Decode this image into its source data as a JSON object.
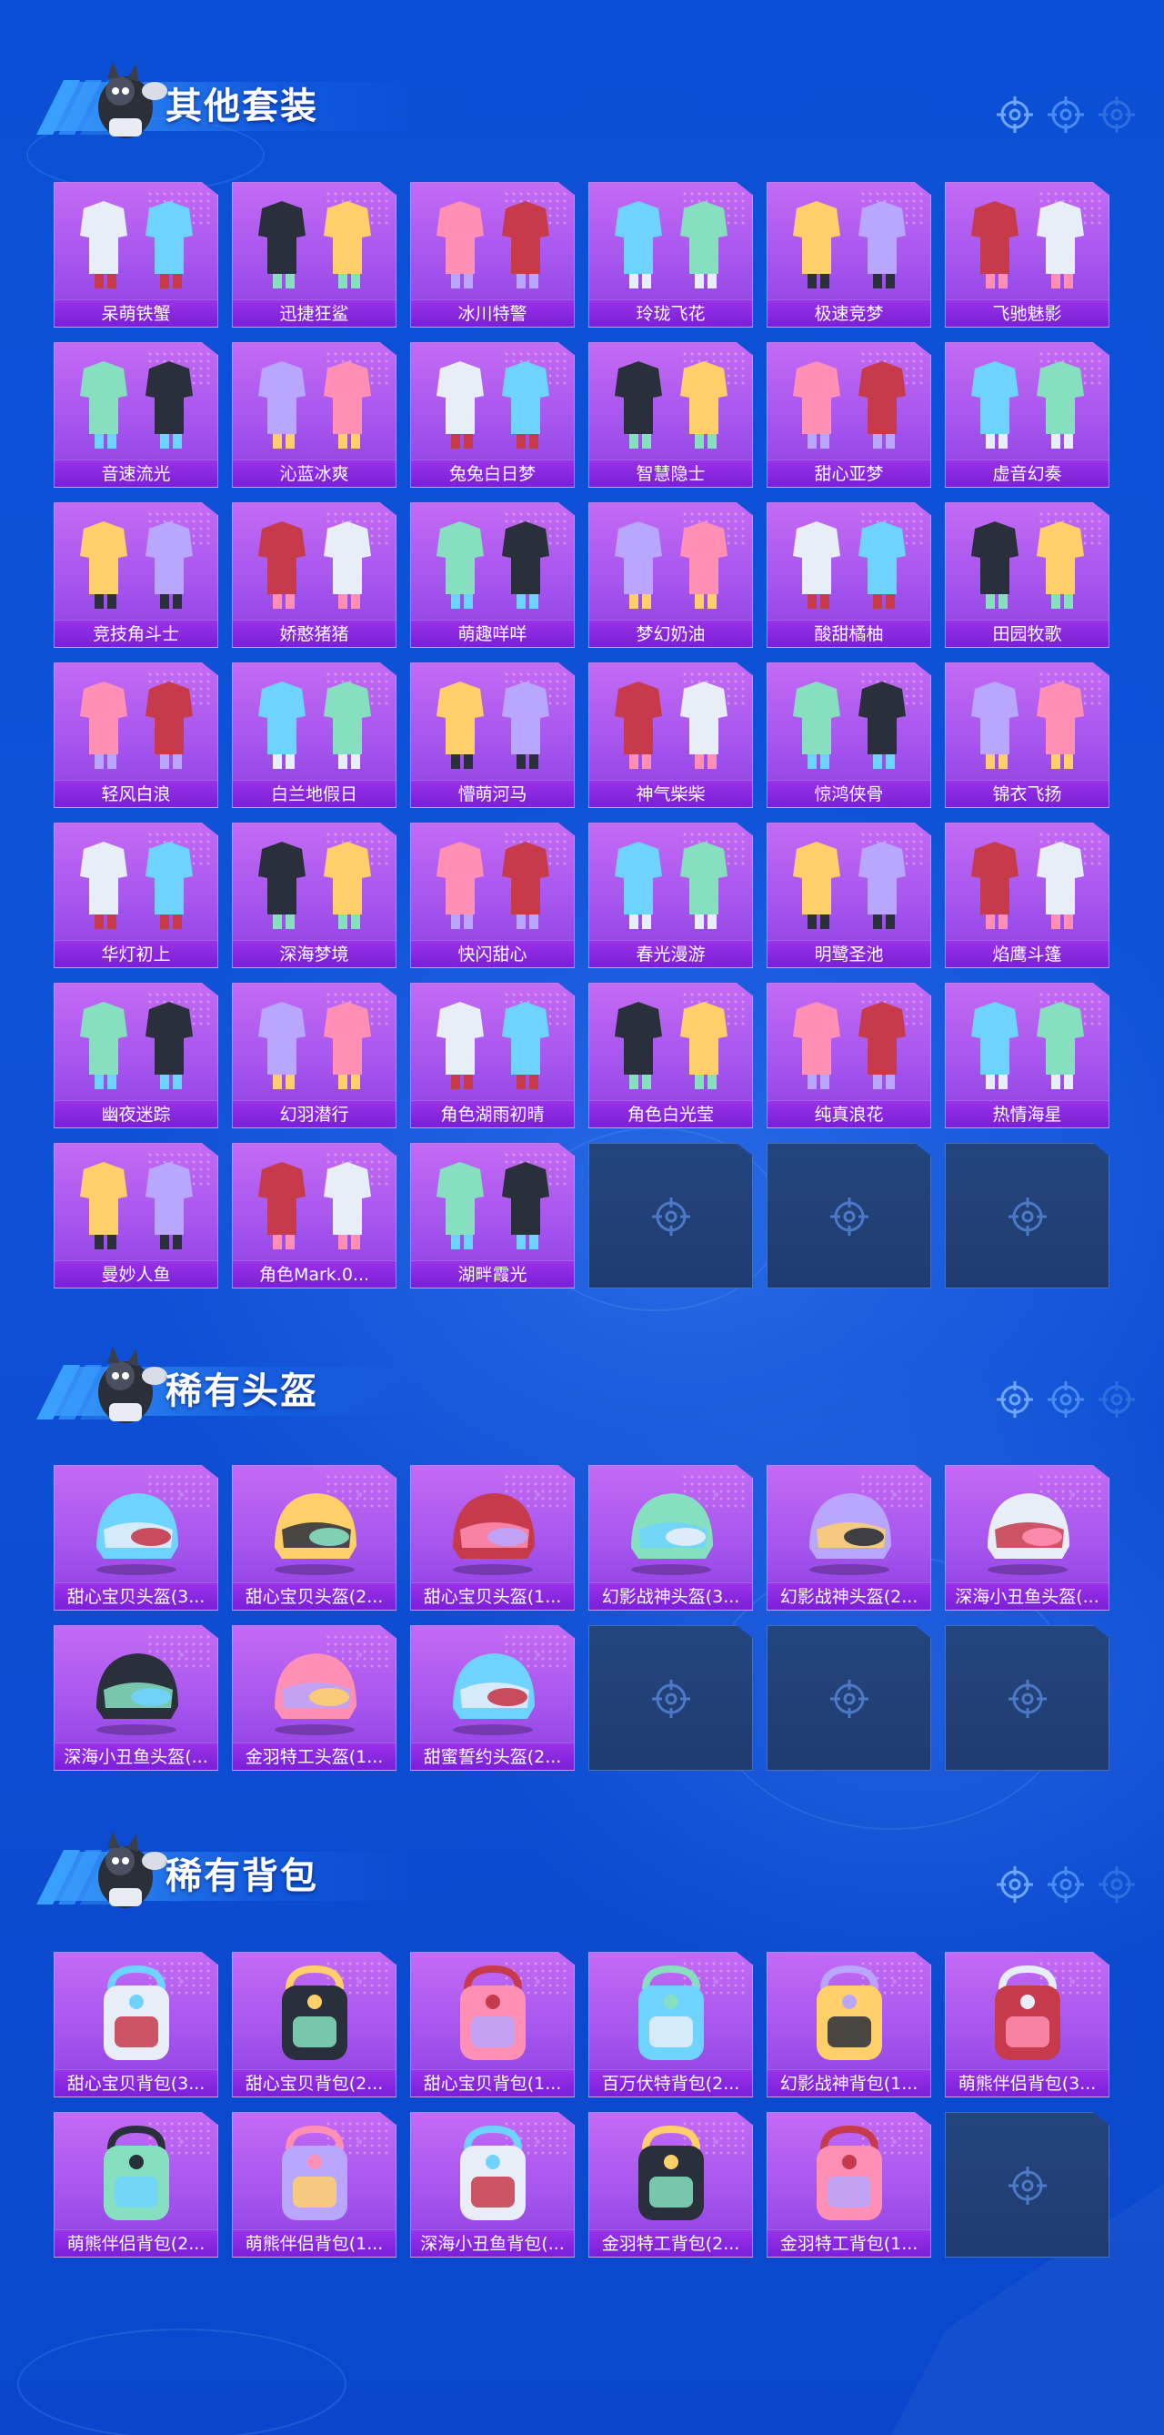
{
  "sections": {
    "suits": {
      "title": "其他套装",
      "items": [
        "呆萌铁蟹",
        "迅捷狂鲨",
        "冰川特警",
        "玲珑飞花",
        "极速竞梦",
        "飞驰魅影",
        "音速流光",
        "沁蓝冰爽",
        "兔兔白日梦",
        "智慧隐士",
        "甜心亚梦",
        "虚音幻奏",
        "竞技角斗士",
        "娇憨猪猪",
        "萌趣咩咩",
        "梦幻奶油",
        "酸甜橘柚",
        "田园牧歌",
        "轻风白浪",
        "白兰地假日",
        "懵萌河马",
        "神气柴柴",
        "惊鸿侠骨",
        "锦衣飞扬",
        "华灯初上",
        "深海梦境",
        "快闪甜心",
        "春光漫游",
        "明鹭圣池",
        "焰鹰斗篷",
        "幽夜迷踪",
        "幻羽潜行",
        "角色湖雨初晴",
        "角色白光莹",
        "纯真浪花",
        "热情海星",
        "曼妙人鱼",
        "角色Mark.0...",
        "湖畔霞光"
      ],
      "empty_slots": 3
    },
    "helmets": {
      "title": "稀有头盔",
      "items": [
        "甜心宝贝头盔(3...",
        "甜心宝贝头盔(2...",
        "甜心宝贝头盔(1...",
        "幻影战神头盔(3...",
        "幻影战神头盔(2...",
        "深海小丑鱼头盔(...",
        "深海小丑鱼头盔(...",
        "金羽特工头盔(1...",
        "甜蜜誓约头盔(2..."
      ],
      "empty_slots": 3
    },
    "backpacks": {
      "title": "稀有背包",
      "items": [
        "甜心宝贝背包(3...",
        "甜心宝贝背包(2...",
        "甜心宝贝背包(1...",
        "百万伏特背包(2...",
        "幻影战神背包(1...",
        "萌熊伴侣背包(3...",
        "萌熊伴侣背包(2...",
        "萌熊伴侣背包(1...",
        "深海小丑鱼背包(...",
        "金羽特工背包(2...",
        "金羽特工背包(1..."
      ],
      "empty_slots": 1
    }
  },
  "icons": {
    "header_decoration": "crosshair-icon",
    "empty_slot": "crosshair-icon",
    "mascot": "mascot-icon"
  },
  "colors": {
    "background": "#0b4fd6",
    "card": "#a655ee",
    "card_label": "#8424dc",
    "empty_slot": "#23457e"
  }
}
